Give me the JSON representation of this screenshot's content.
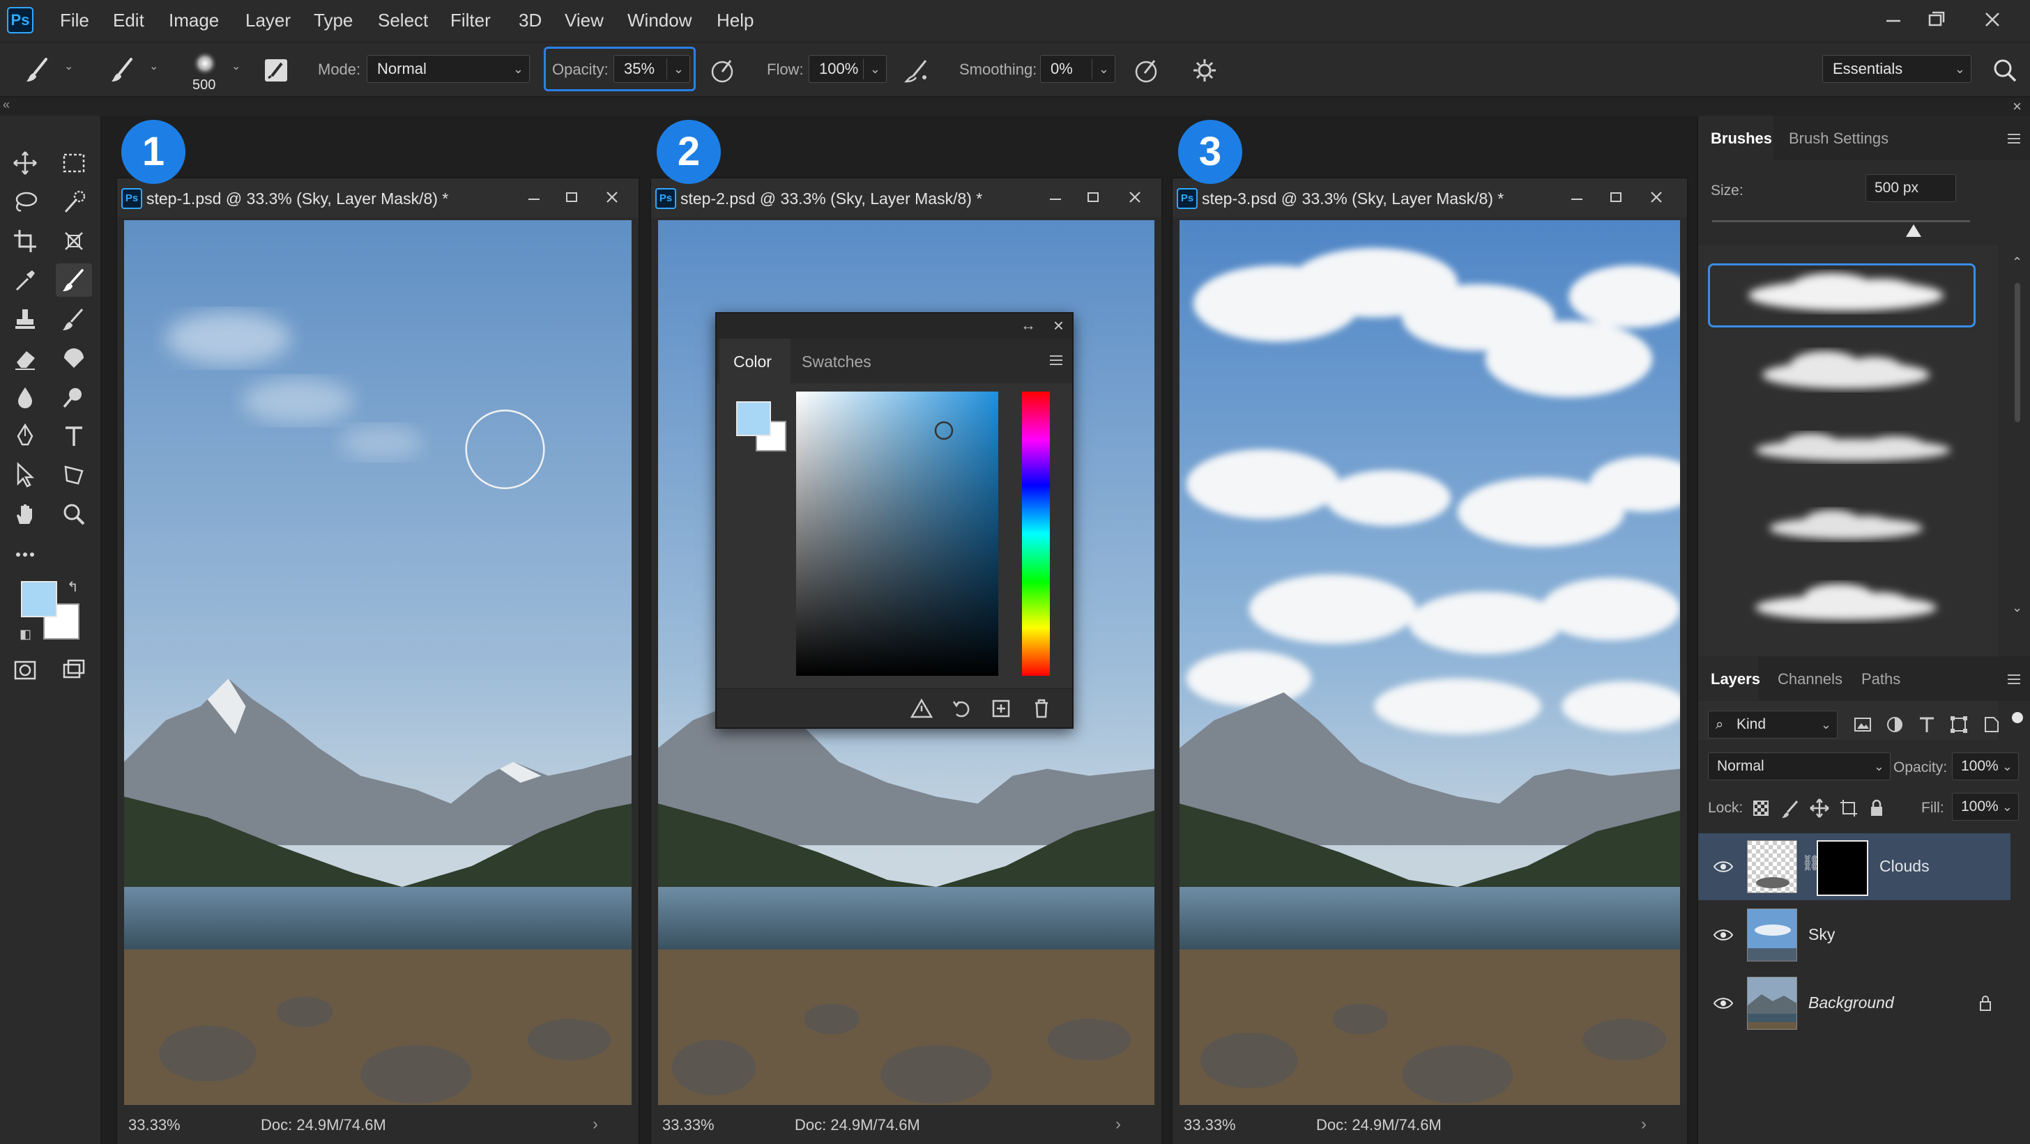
{
  "app": {
    "logo": "Ps"
  },
  "menu": [
    "File",
    "Edit",
    "Image",
    "Layer",
    "Type",
    "Select",
    "Filter",
    "3D",
    "View",
    "Window",
    "Help"
  ],
  "options": {
    "brush_size": "500",
    "mode_label": "Mode:",
    "mode_value": "Normal",
    "opacity_label": "Opacity:",
    "opacity_value": "35%",
    "flow_label": "Flow:",
    "flow_value": "100%",
    "smoothing_label": "Smoothing:",
    "smoothing_value": "0%",
    "workspace": "Essentials"
  },
  "documents": [
    {
      "step": "1",
      "title": "step-1.psd @ 33.3% (Sky, Layer Mask/8) *",
      "zoom": "33.33%",
      "doc_info": "Doc: 24.9M/74.6M"
    },
    {
      "step": "2",
      "title": "step-2.psd @ 33.3% (Sky, Layer Mask/8) *",
      "zoom": "33.33%",
      "doc_info": "Doc: 24.9M/74.6M"
    },
    {
      "step": "3",
      "title": "step-3.psd @ 33.3% (Sky, Layer Mask/8) *",
      "zoom": "33.33%",
      "doc_info": "Doc: 24.9M/74.6M"
    }
  ],
  "color_panel": {
    "tabs": [
      "Color",
      "Swatches"
    ],
    "foreground_color": "#a8d6f5",
    "background_color": "#ffffff"
  },
  "brushes_panel": {
    "tabs": [
      "Brushes",
      "Brush Settings"
    ],
    "size_label": "Size:",
    "size_value": "500 px",
    "size_slider_fraction": 0.78,
    "presets": [
      "cloud-brush-1",
      "cloud-brush-2",
      "cloud-brush-3",
      "cloud-brush-4",
      "cloud-brush-5"
    ]
  },
  "layers_panel": {
    "tabs": [
      "Layers",
      "Channels",
      "Paths"
    ],
    "filter_value": "Kind",
    "blend_mode": "Normal",
    "opacity_label": "Opacity:",
    "opacity_value": "100%",
    "lock_label": "Lock:",
    "fill_label": "Fill:",
    "fill_value": "100%",
    "layers": [
      {
        "name": "Clouds",
        "selected": true
      },
      {
        "name": "Sky",
        "selected": false
      },
      {
        "name": "Background",
        "selected": false,
        "locked": true
      }
    ]
  },
  "colors": {
    "accent": "#1d7fe6",
    "selection": "#3b4c63",
    "ps_blue": "#31a8ff"
  }
}
